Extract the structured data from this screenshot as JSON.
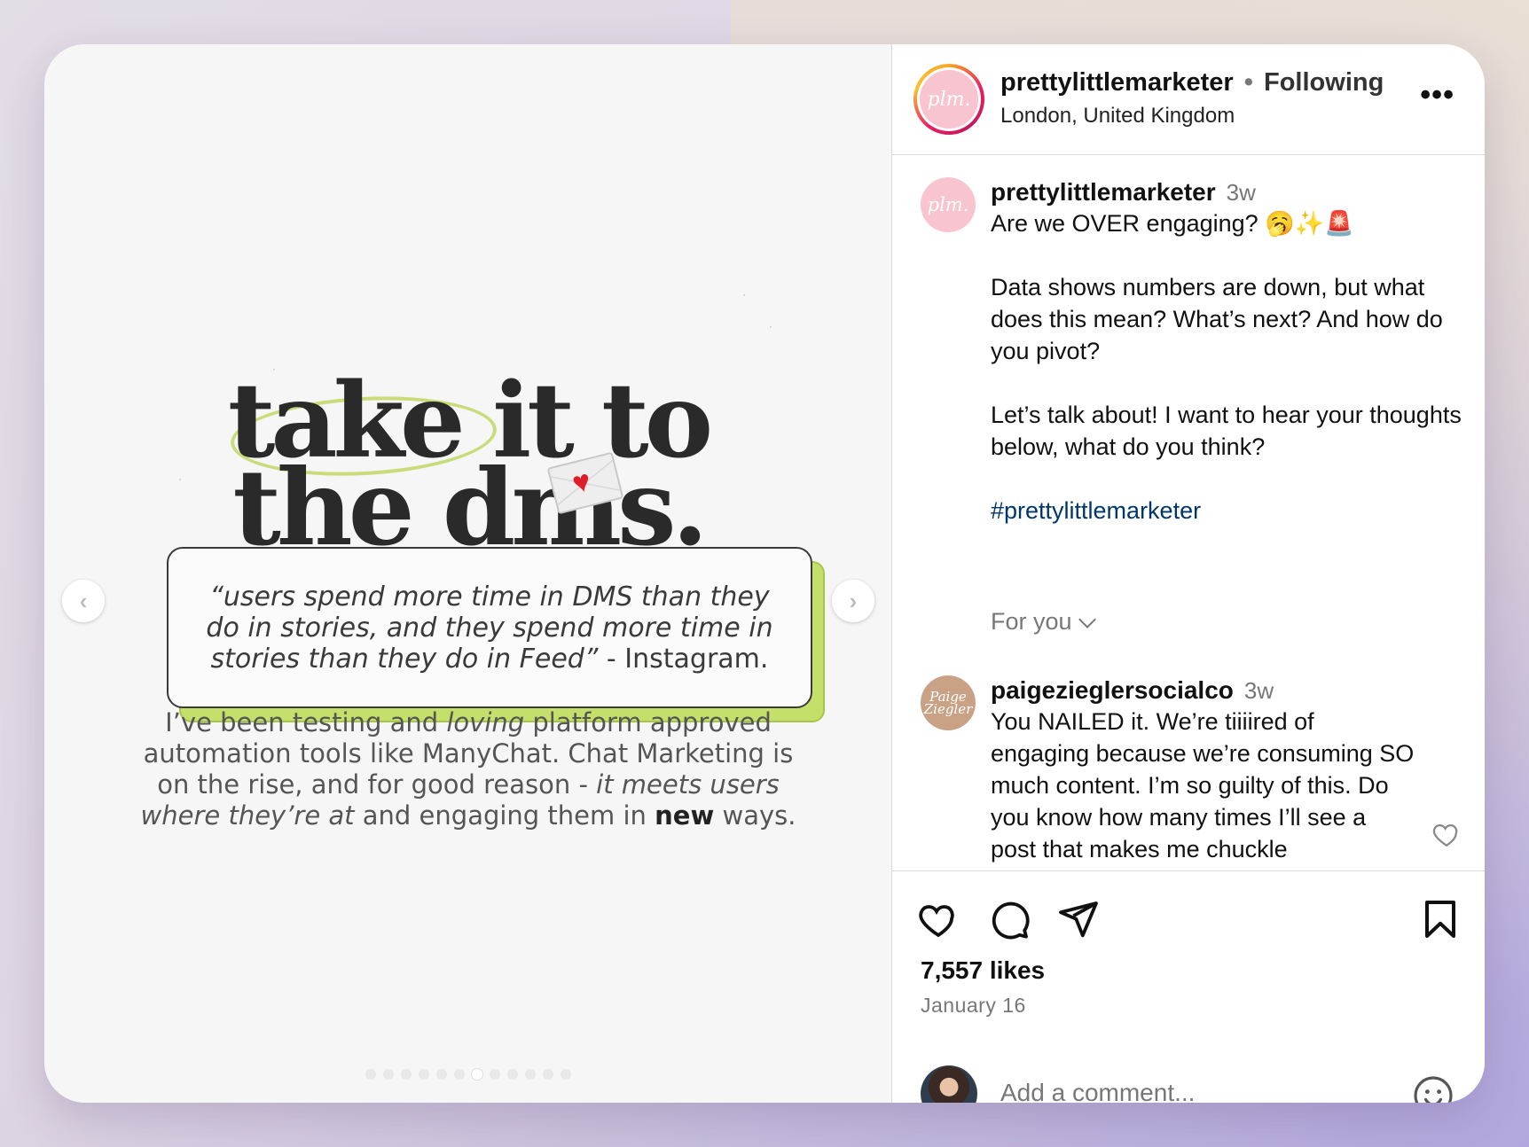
{
  "media": {
    "headline_line1": "take it to",
    "headline_line2": "the dms.",
    "quote": "“users spend more time in DMS than they do in stories, and they spend more time in stories than they do in Feed”",
    "quote_source": " - Instagram.",
    "body_1": "I’ve been testing and ",
    "body_loving": "loving",
    "body_2": " platform approved automation tools like ManyChat. Chat Marketing is on the rise, and for good reason - ",
    "body_italic": "it meets users where they’re at",
    "body_3": " and engaging them in ",
    "body_bold": "new",
    "body_4": " ways.",
    "prev_glyph": "‹",
    "next_glyph": "›",
    "carousel_total": 12,
    "carousel_active": 7
  },
  "header": {
    "avatar_text": "plm.",
    "username": "prettylittlemarketer",
    "separator": "•",
    "follow_status": "Following",
    "location": "London, United Kingdom",
    "more_glyph": "•••"
  },
  "caption": {
    "avatar_text": "plm.",
    "username": "prettylittlemarketer",
    "time": "3w",
    "line1": "Are we OVER engaging? 🥱✨🚨",
    "para2": "Data shows numbers are down, but what does this mean? What’s next? And how do you pivot?",
    "para3": "Let’s talk about! I want to hear your thoughts below, what do you think?",
    "hashtag": "#prettylittlemarketer"
  },
  "for_you": "For you",
  "comment": {
    "avatar_text": "Paige Ziegler",
    "username": "paigezieglersocialco",
    "time": "3w",
    "text": "You NAILED it. We’re tiiiired of engaging because we’re consuming SO much content. I’m so guilty of this. Do you know how many times I’ll see a post that makes me chuckle"
  },
  "actions": {
    "likes": "7,557 likes",
    "date": "January 16",
    "comment_placeholder": "Add a comment..."
  }
}
